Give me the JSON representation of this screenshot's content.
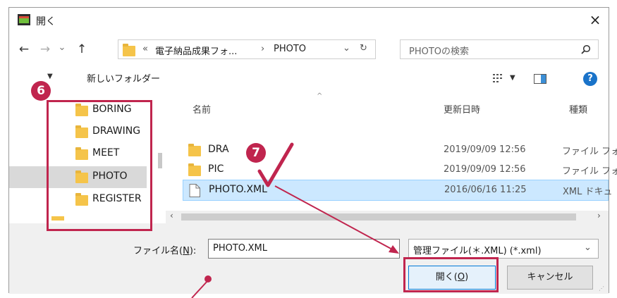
{
  "window": {
    "title": "開く",
    "close_glyph": "×",
    "icon": "app-icon"
  },
  "address": {
    "back_glyph": "←",
    "forward_glyph": "→",
    "recent_glyph": "⌄",
    "up_glyph": "↑",
    "breadcrumb_prefix": "«",
    "crumb1": "電子納品成果フォ...",
    "separator": "›",
    "crumb2": "PHOTO",
    "dropdown_glyph": "⌄",
    "refresh_glyph": "↻",
    "search_placeholder": "PHOTOの検索",
    "search_icon": "search-icon"
  },
  "toolbar": {
    "organize_glyph": "▼",
    "new_folder": "新しいフォルダー",
    "view_glyph": "▼",
    "help_glyph": "?"
  },
  "nav_tree": {
    "items": [
      {
        "label": "BORING"
      },
      {
        "label": "DRAWING"
      },
      {
        "label": "MEET"
      },
      {
        "label": "PHOTO"
      },
      {
        "label": "REGISTER"
      }
    ]
  },
  "file_list": {
    "columns": {
      "name": "名前",
      "date": "更新日時",
      "type": "種類"
    },
    "rows": [
      {
        "name": "DRA",
        "date": "2019/09/09 12:56",
        "type": "ファイル フォ"
      },
      {
        "name": "PIC",
        "date": "2019/09/09 12:56",
        "type": "ファイル フォ"
      },
      {
        "name": "PHOTO.XML",
        "date": "2016/06/16 11:25",
        "type": "XML ドキュ"
      }
    ]
  },
  "bottom": {
    "filename_label": "ファイル名(",
    "filename_accel": "N",
    "filename_label_end": "):",
    "filename_value": "PHOTO.XML",
    "filter_value": "管理ファイル(＊.XML) (*.xml)",
    "open_label": "開く(",
    "open_accel": "O",
    "open_label_end": ")",
    "cancel_label": "キャンセル"
  },
  "annotations": {
    "step6": "6",
    "step7": "7",
    "accent_color": "#c0254e",
    "selection_color": "#cce8ff"
  }
}
